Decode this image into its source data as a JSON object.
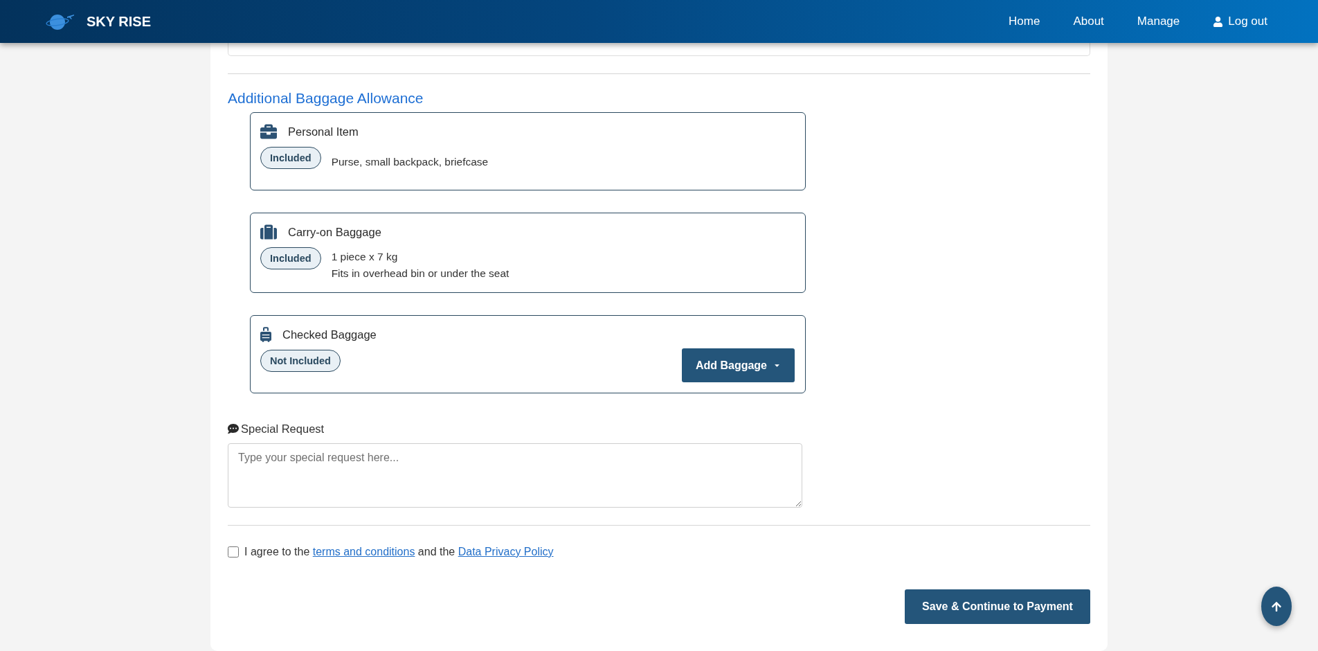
{
  "header": {
    "brand": "SKY RISE",
    "nav": [
      {
        "label": "Home",
        "kind": "link"
      },
      {
        "label": "About",
        "kind": "link"
      },
      {
        "label": "Manage",
        "kind": "link"
      },
      {
        "label": "Log out",
        "kind": "account"
      }
    ]
  },
  "baggage": {
    "title": "Additional Baggage Allowance",
    "items": [
      {
        "kind": "briefcase",
        "title": "Personal Item",
        "status": "Included",
        "details": [
          "Purse, small backpack, briefcase"
        ]
      },
      {
        "kind": "suitcase",
        "title": "Carry-on Baggage",
        "status": "Included",
        "details": [
          "1 piece x 7 kg",
          "Fits in overhead bin or under the seat"
        ]
      },
      {
        "kind": "rolling",
        "title": "Checked Baggage",
        "status": "Not Included",
        "action": "Add Baggage"
      }
    ]
  },
  "special_request": {
    "label": "Special Request",
    "placeholder": "Type your special request here..."
  },
  "agreement": {
    "checked": false,
    "segments": [
      {
        "kind": "text",
        "text": "I agree to the"
      },
      {
        "kind": "link",
        "text": "terms and conditions"
      },
      {
        "kind": "text",
        "text": "and the"
      },
      {
        "kind": "link",
        "text": "Data Privacy Policy"
      }
    ]
  },
  "submit": "Save & Continue to Payment"
}
